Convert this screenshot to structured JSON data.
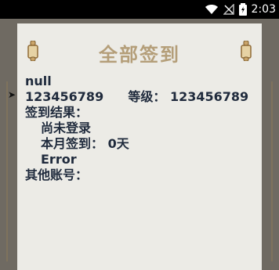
{
  "status_bar": {
    "time": "2:03",
    "icons": [
      "wifi-icon",
      "signal-off-icon",
      "battery-charging-icon"
    ]
  },
  "dialog": {
    "title": "全部签到",
    "lines": {
      "name": "null",
      "id": "123456789",
      "level_label": "等级：",
      "level_value": "123456789",
      "result_label": "签到结果：",
      "login_status": "尚未登录",
      "monthly_label": "本月签到：",
      "monthly_value": "0天",
      "error": "Error",
      "other_accounts_label": "其他账号："
    }
  },
  "colors": {
    "title": "#b49e79",
    "text": "#1f2a3c",
    "paper": "#ecebe6",
    "status_bar": "#000000"
  }
}
